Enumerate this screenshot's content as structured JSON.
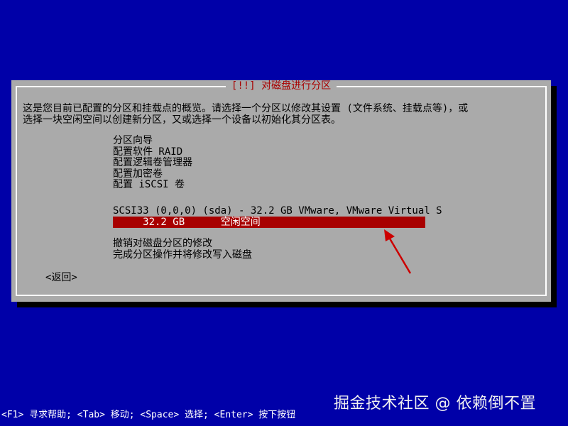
{
  "dialog": {
    "title": "[!!] 对磁盘进行分区",
    "description_line1": "这是您目前已配置的分区和挂载点的概览。请选择一个分区以修改其设置 (文件系统、挂载点等)，或",
    "description_line2": "选择一块空闲空间以创建新分区，又或选择一个设备以初始化其分区表。",
    "menu_items": [
      "分区向导",
      "配置软件 RAID",
      "配置逻辑卷管理器",
      "配置加密卷",
      "配置 iSCSI 卷"
    ],
    "disk": "SCSI33 (0,0,0) (sda) - 32.2 GB VMware, VMware Virtual S",
    "selected_partition": "     32.2 GB      空闲空间",
    "actions": [
      "撤销对磁盘分区的修改",
      "完成分区操作并将修改写入磁盘"
    ],
    "back_label": "<返回>"
  },
  "statusbar": "<F1> 寻求帮助; <Tab> 移动; <Space> 选择; <Enter> 按下按钮",
  "watermark": "掘金技术社区 @ 依赖倒不置",
  "colors": {
    "background": "#0000a8",
    "dialog": "#aaaaaa",
    "highlight": "#a80000",
    "title_text": "#a80000",
    "annotation_arrow": "#cc0000"
  }
}
